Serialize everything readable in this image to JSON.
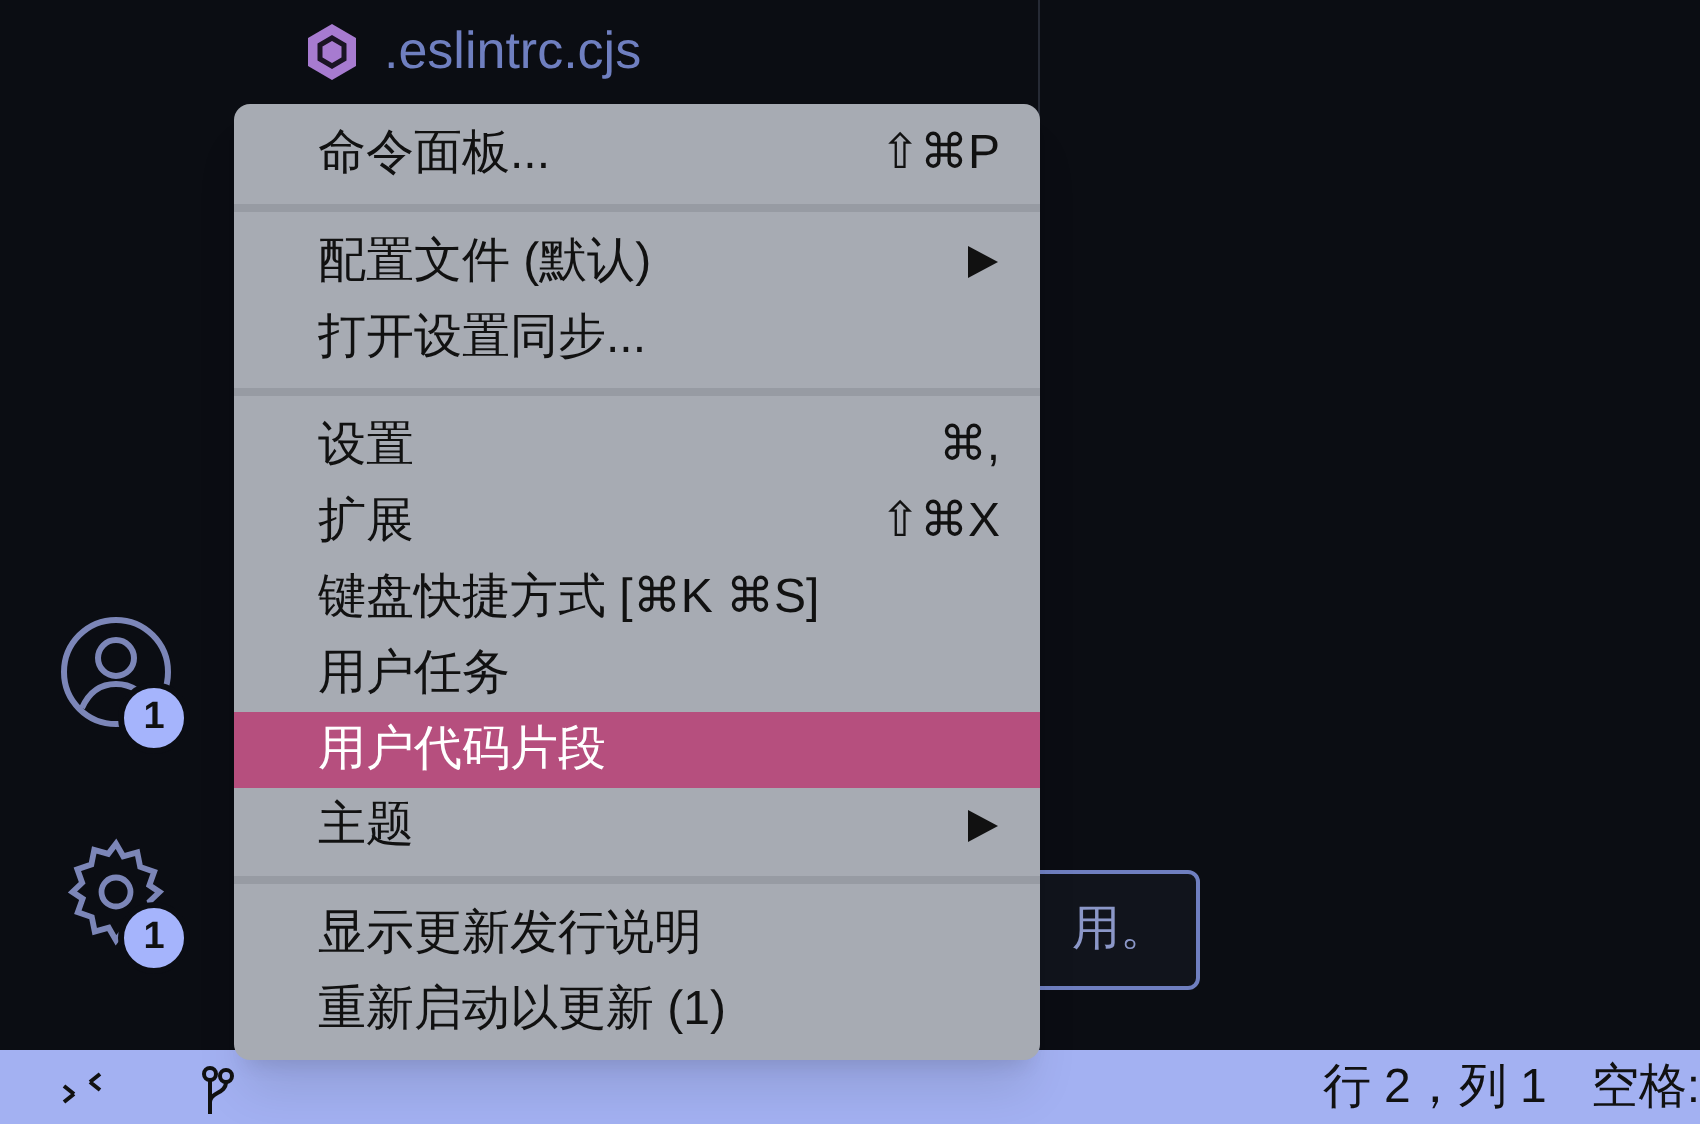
{
  "file": {
    "name": ".eslintrc.cjs"
  },
  "activity_bar": [
    {
      "kind": "account",
      "badge": "1"
    },
    {
      "kind": "settings",
      "badge": "1"
    }
  ],
  "tooltip": {
    "text": "用。"
  },
  "menu": {
    "groups": [
      [
        {
          "label": "命令面板...",
          "shortcut": "⇧⌘P",
          "submenu": false,
          "selected": false
        }
      ],
      [
        {
          "label": "配置文件 (默认)",
          "submenu": true,
          "selected": false
        },
        {
          "label": "打开设置同步...",
          "submenu": false,
          "selected": false
        }
      ],
      [
        {
          "label": "设置",
          "shortcut": "⌘,",
          "submenu": false,
          "selected": false
        },
        {
          "label": "扩展",
          "shortcut": "⇧⌘X",
          "submenu": false,
          "selected": false
        },
        {
          "label": "键盘快捷方式 [⌘K ⌘S]",
          "submenu": false,
          "selected": false
        },
        {
          "label": "用户任务",
          "submenu": false,
          "selected": false
        },
        {
          "label": "用户代码片段",
          "submenu": false,
          "selected": true
        },
        {
          "label": "主题",
          "submenu": true,
          "selected": false
        }
      ],
      [
        {
          "label": "显示更新发行说明",
          "submenu": false,
          "selected": false
        },
        {
          "label": "重新启动以更新 (1)",
          "submenu": false,
          "selected": false
        }
      ]
    ]
  },
  "status_bar": {
    "right": [
      "行 2，列 1",
      "空格:"
    ]
  }
}
